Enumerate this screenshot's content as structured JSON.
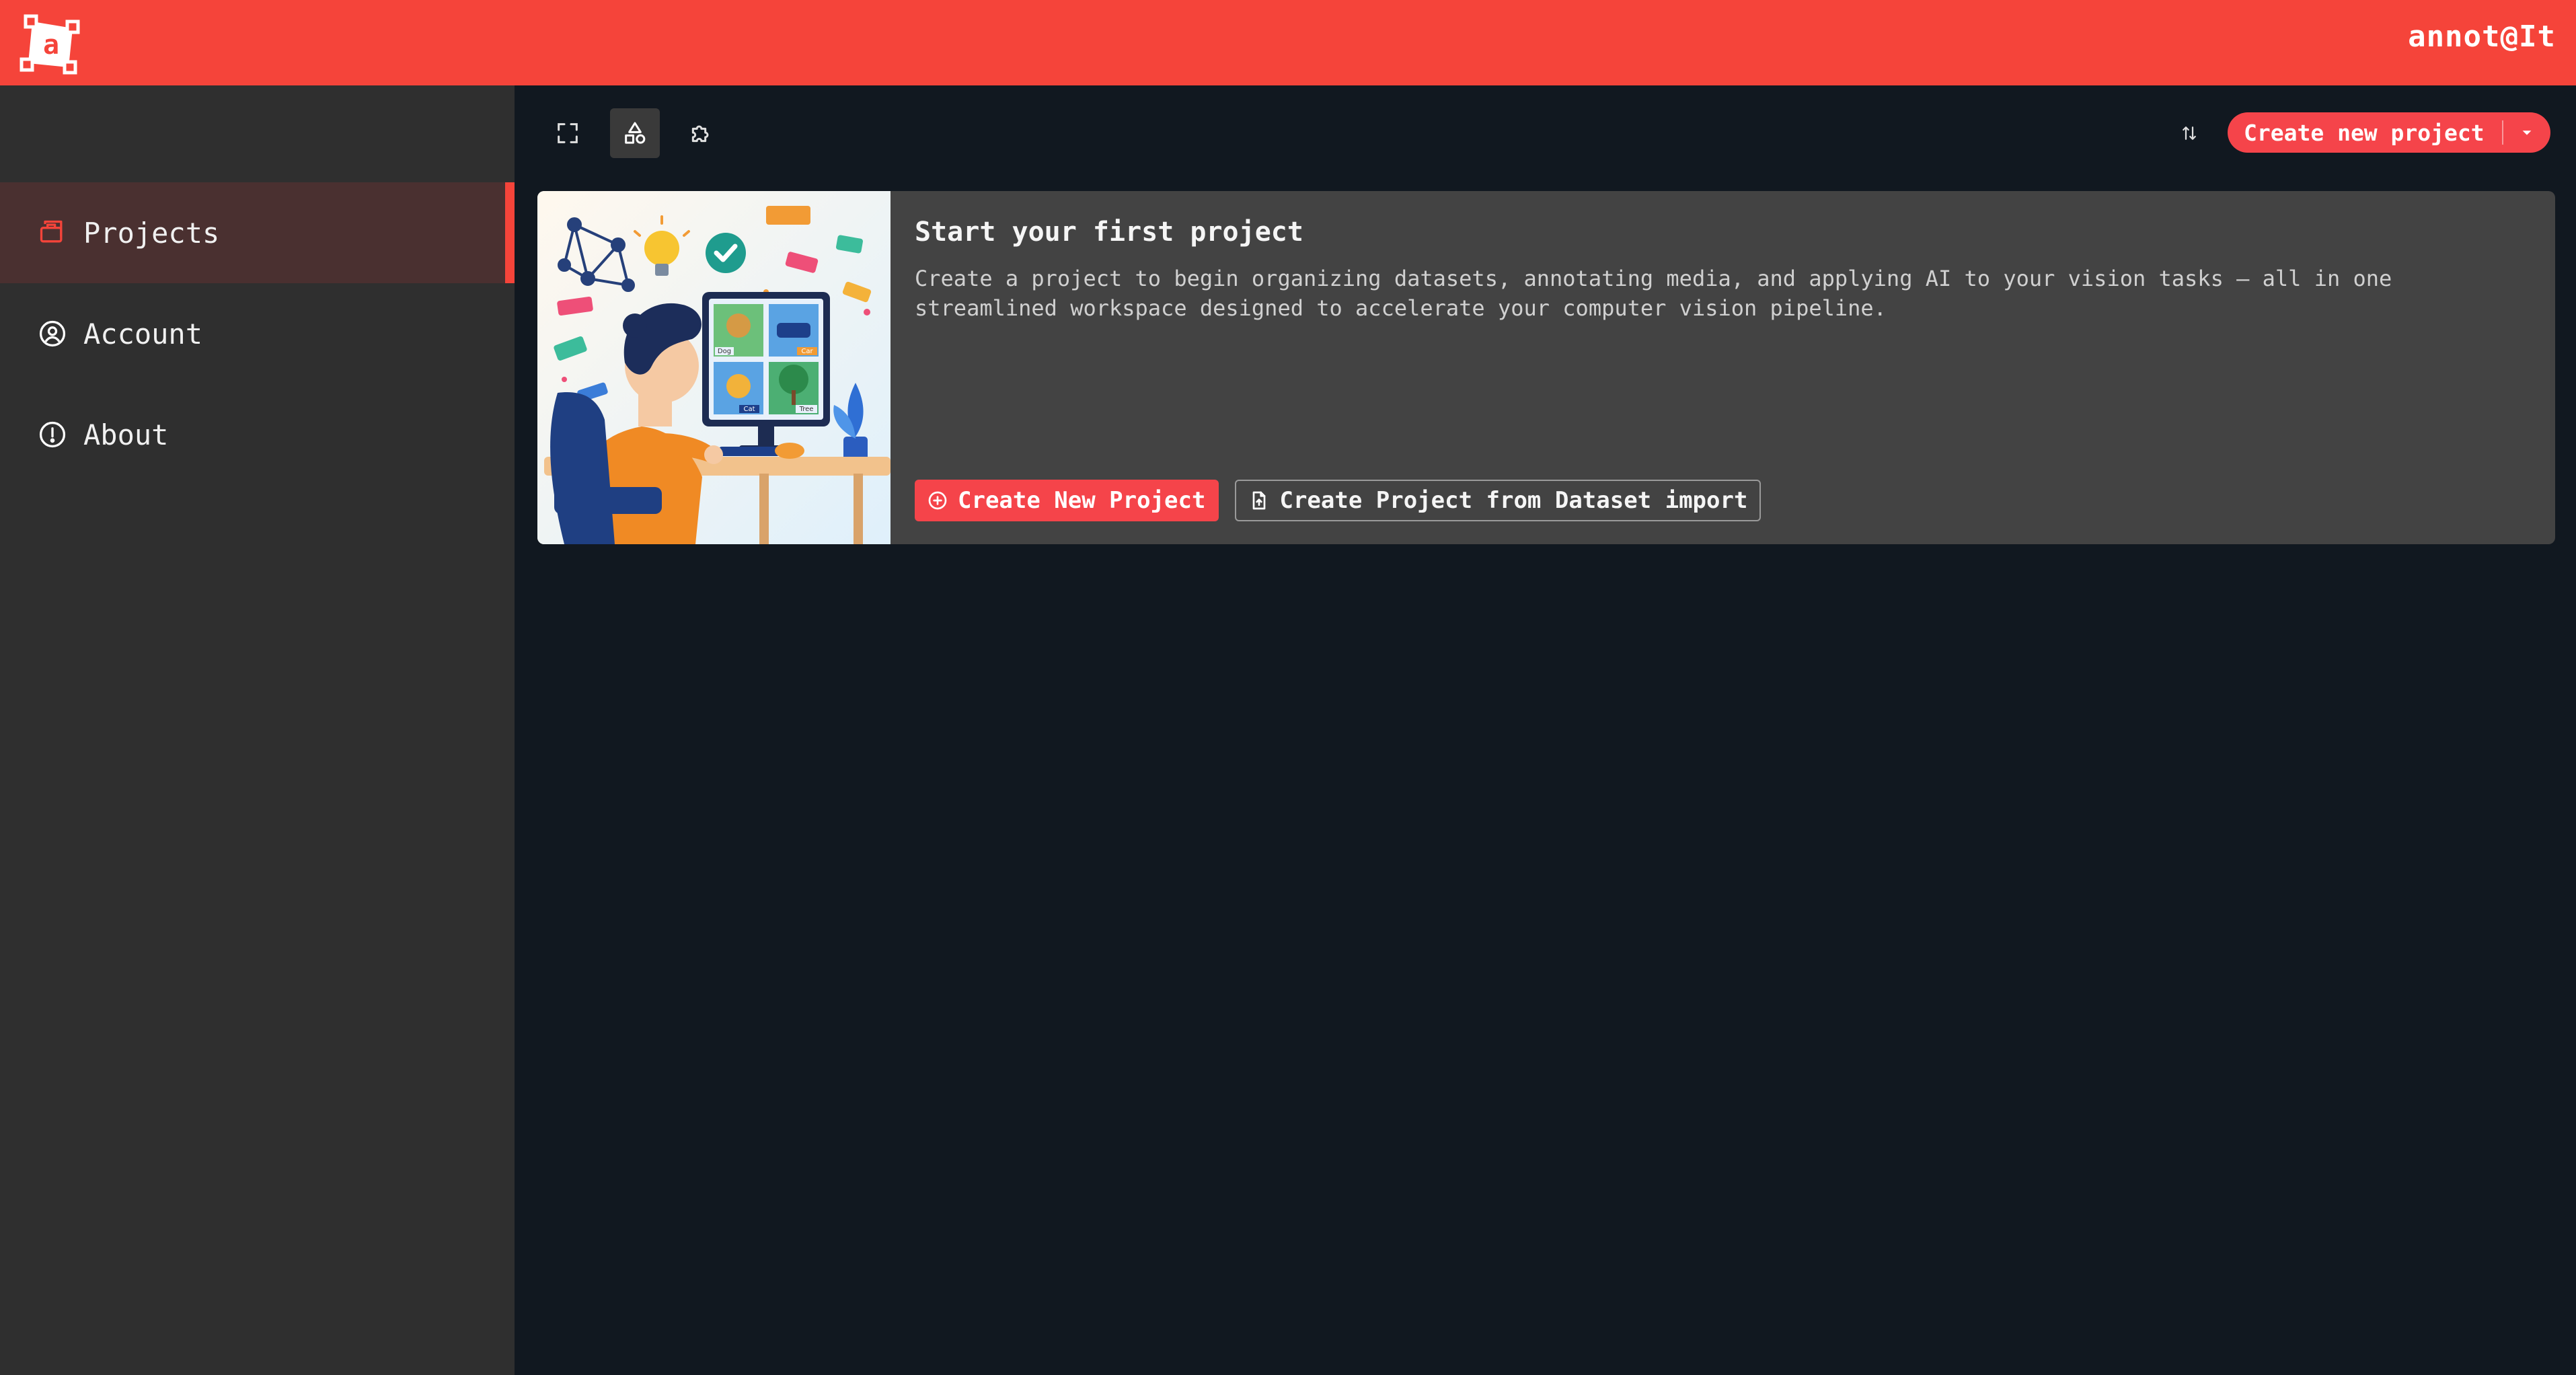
{
  "header": {
    "app_title": "annot@It",
    "logo_letter": "a",
    "accent_color": "#f5443a"
  },
  "sidebar": {
    "items": [
      {
        "label": "Projects",
        "icon": "briefcase-icon",
        "active": true
      },
      {
        "label": "Account",
        "icon": "user-circle-icon",
        "active": false
      },
      {
        "label": "About",
        "icon": "info-circle-icon",
        "active": false
      }
    ]
  },
  "toolbar": {
    "tools": [
      {
        "icon": "fullscreen-icon",
        "selected": false
      },
      {
        "icon": "shapes-icon",
        "selected": true
      },
      {
        "icon": "puzzle-icon",
        "selected": false
      }
    ],
    "sort_icon": "sort-icon",
    "create_label": "Create new project",
    "create_menu_icon": "chevron-down-icon"
  },
  "empty_state": {
    "title": "Start your first project",
    "description": "Create a project to begin organizing datasets, annotating media, and applying AI to your vision tasks — all in one streamlined workspace designed to accelerate your computer vision pipeline.",
    "primary_label": "Create New Project",
    "primary_icon": "plus-circle-icon",
    "secondary_label": "Create Project from Dataset import",
    "secondary_icon": "file-import-icon",
    "illustration_labels": [
      "Dog",
      "Car",
      "Cat",
      "Tree"
    ]
  }
}
